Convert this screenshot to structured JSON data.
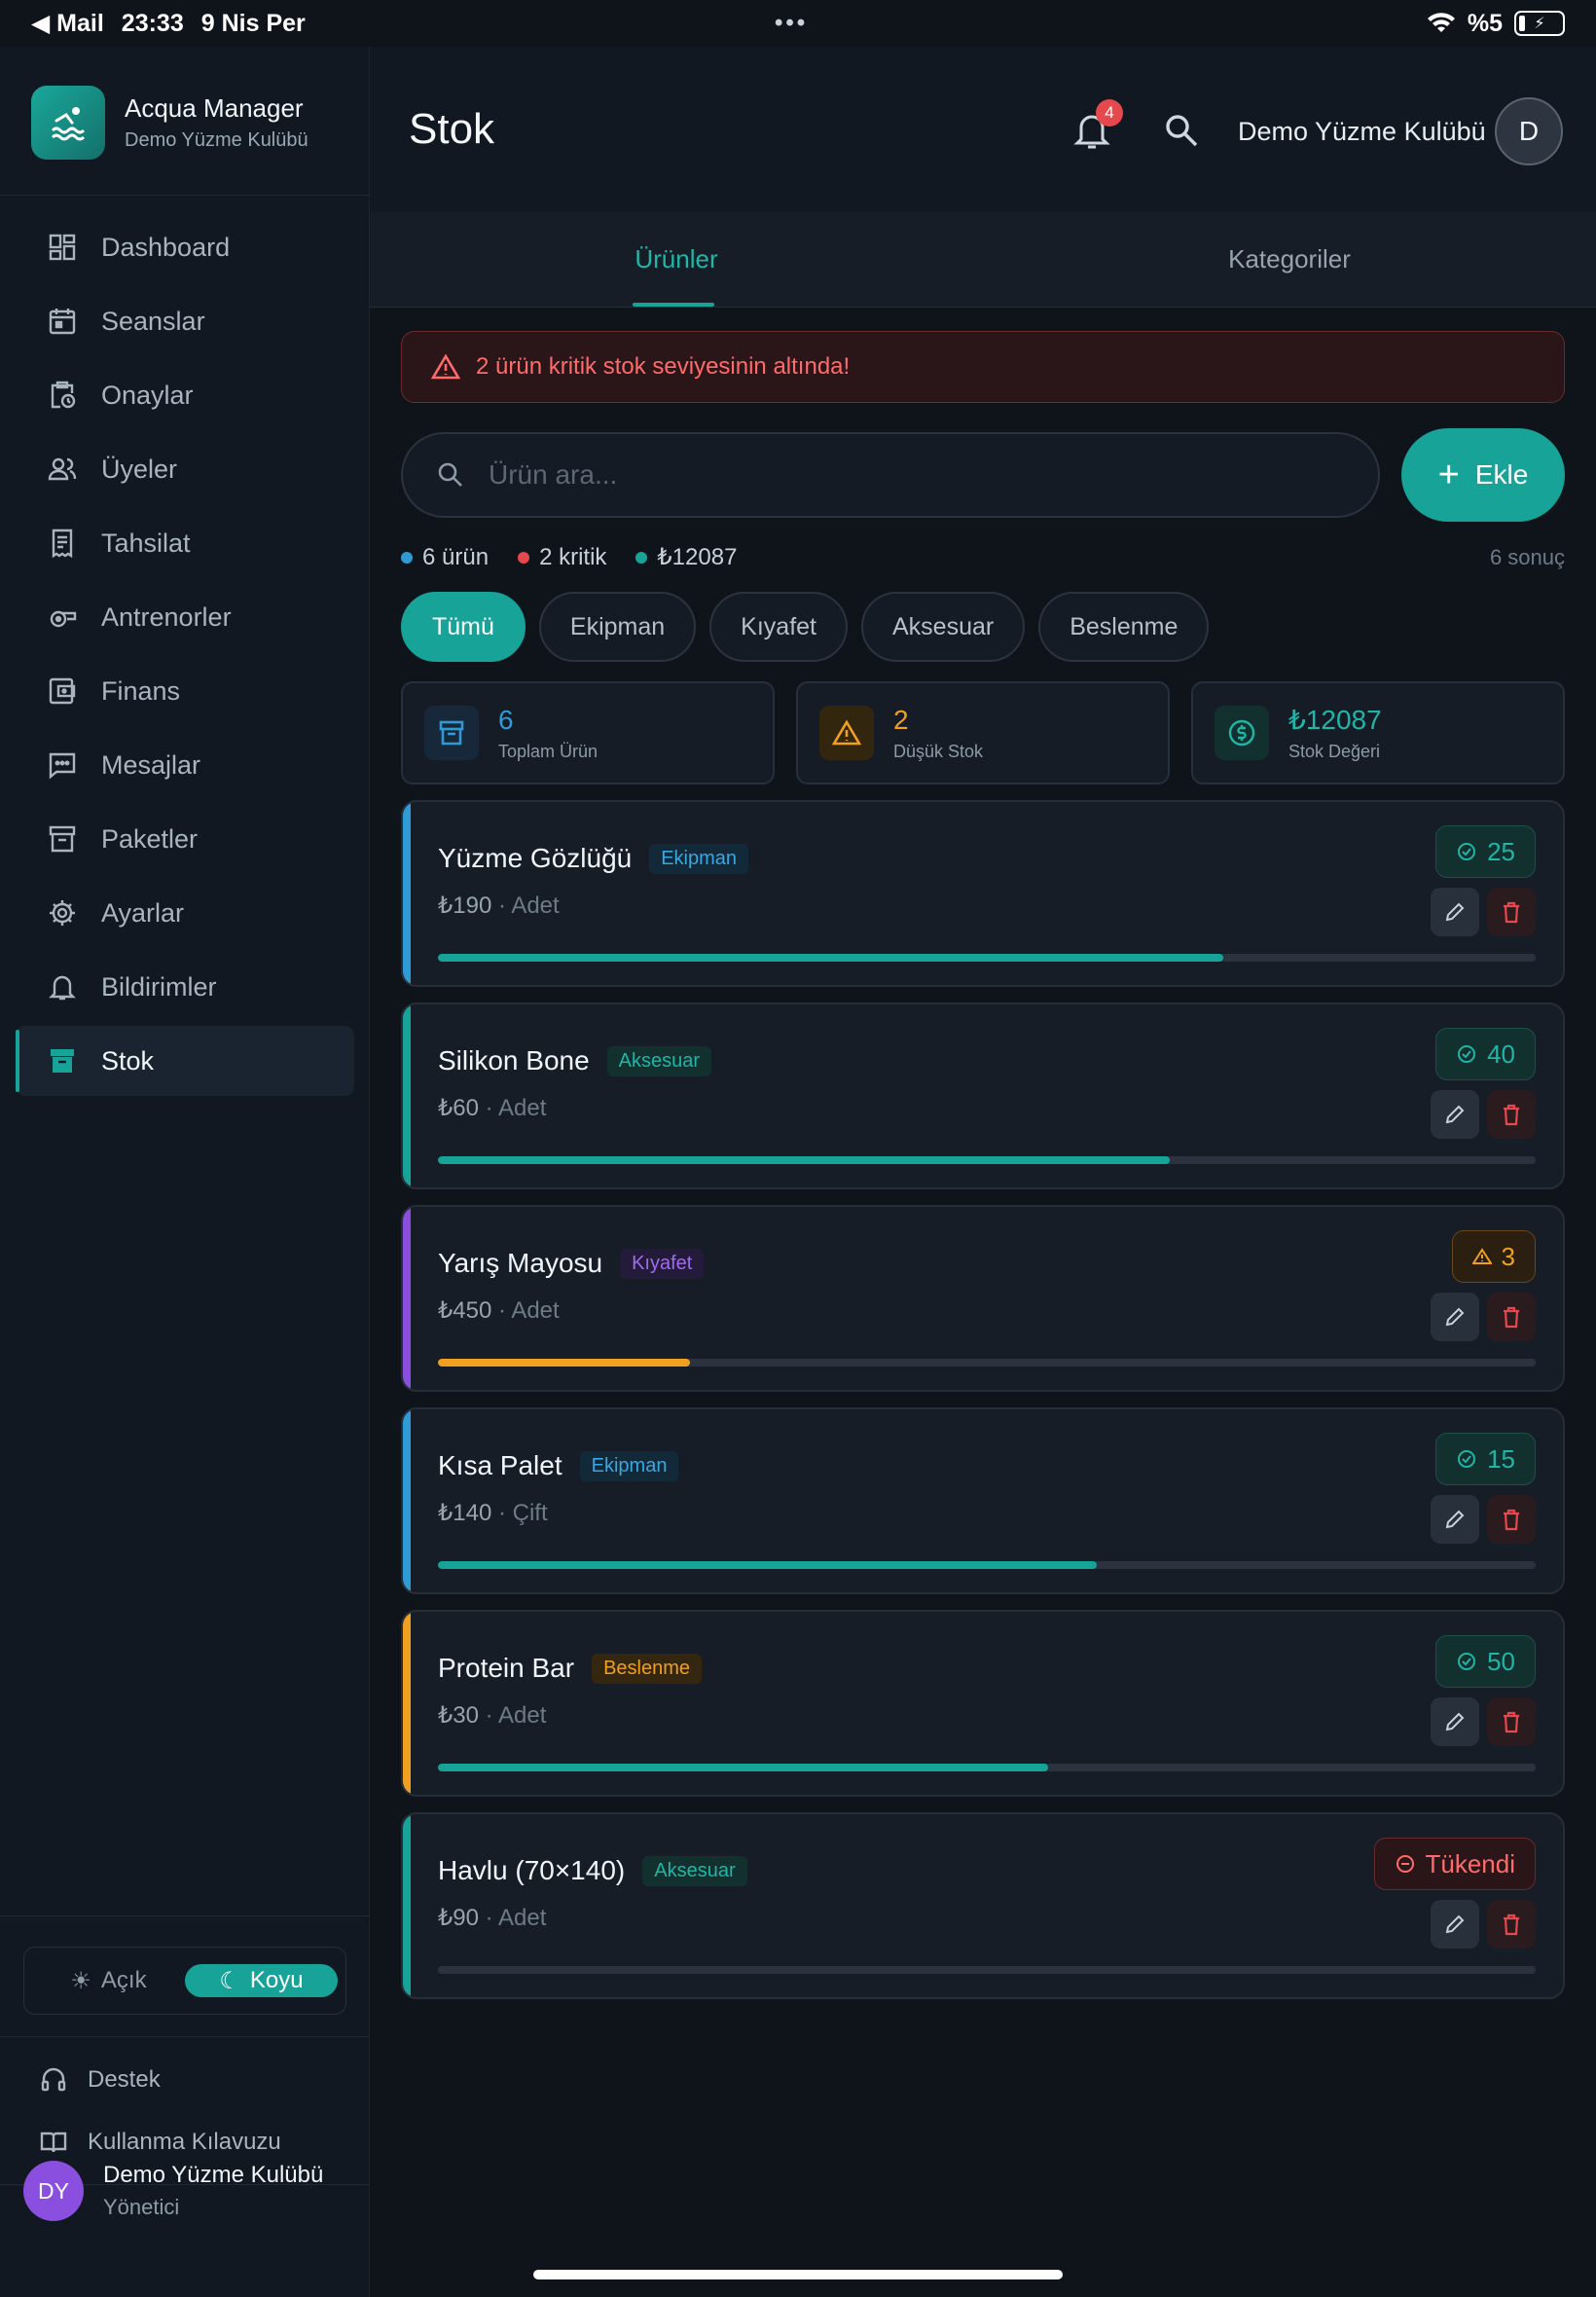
{
  "status_bar": {
    "back_app": "Mail",
    "time": "23:33",
    "date": "9 Nis Per",
    "battery": "%5"
  },
  "brand": {
    "title": "Acqua Manager",
    "subtitle": "Demo Yüzme Kulübü"
  },
  "nav": {
    "items": [
      {
        "label": "Dashboard",
        "icon": "dashboard-icon"
      },
      {
        "label": "Seanslar",
        "icon": "calendar-icon"
      },
      {
        "label": "Onaylar",
        "icon": "clipboard-clock-icon"
      },
      {
        "label": "Üyeler",
        "icon": "users-icon"
      },
      {
        "label": "Tahsilat",
        "icon": "receipt-icon"
      },
      {
        "label": "Antrenorler",
        "icon": "whistle-icon"
      },
      {
        "label": "Finans",
        "icon": "wallet-icon"
      },
      {
        "label": "Mesajlar",
        "icon": "message-icon"
      },
      {
        "label": "Paketler",
        "icon": "archive-icon"
      },
      {
        "label": "Ayarlar",
        "icon": "gear-icon"
      },
      {
        "label": "Bildirimler",
        "icon": "bell-icon"
      },
      {
        "label": "Stok",
        "icon": "archive-icon",
        "active": true
      }
    ]
  },
  "theme": {
    "light": "Açık",
    "dark": "Koyu",
    "selected": "Koyu"
  },
  "help": {
    "support": "Destek",
    "guide": "Kullanma Kılavuzu"
  },
  "user": {
    "initials": "DY",
    "name": "Demo Yüzme Kulübü",
    "role": "Yönetici"
  },
  "header": {
    "title": "Stok",
    "notification_count": "4",
    "club_name": "Demo Yüzme Kulübü",
    "avatar": "D"
  },
  "tabs": [
    {
      "label": "Ürünler",
      "active": true
    },
    {
      "label": "Kategoriler"
    }
  ],
  "alert": {
    "text": "2 ürün kritik stok seviyesinin altında!"
  },
  "search": {
    "placeholder": "Ürün ara..."
  },
  "add_button": {
    "label": "Ekle"
  },
  "summary": {
    "products": "6 ürün",
    "critical": "2 kritik",
    "value": "₺12087",
    "results": "6 sonuç"
  },
  "filters": [
    "Tümü",
    "Ekipman",
    "Kıyafet",
    "Aksesuar",
    "Beslenme"
  ],
  "active_filter": "Tümü",
  "stats": [
    {
      "value": "6",
      "label": "Toplam Ürün",
      "color": "#2f9bd6"
    },
    {
      "value": "2",
      "label": "Düşük Stok",
      "color": "#f0a020"
    },
    {
      "value": "₺12087",
      "label": "Stok Değeri",
      "color": "#1fb5a8"
    }
  ],
  "products": [
    {
      "name": "Yüzme Gözlüğü",
      "category": "Ekipman",
      "price": "₺190",
      "unit": "Adet",
      "stock": "25",
      "status": "ok",
      "level": 0.715,
      "accent": "#2f9bd6"
    },
    {
      "name": "Silikon Bone",
      "category": "Aksesuar",
      "price": "₺60",
      "unit": "Adet",
      "stock": "40",
      "status": "ok",
      "level": 0.667,
      "accent": "#17a398"
    },
    {
      "name": "Yarış Mayosu",
      "category": "Kıyafet",
      "price": "₺450",
      "unit": "Adet",
      "stock": "3",
      "status": "low",
      "level": 0.23,
      "accent": "#8b4fe0"
    },
    {
      "name": "Kısa Palet",
      "category": "Ekipman",
      "price": "₺140",
      "unit": "Çift",
      "stock": "15",
      "status": "ok",
      "level": 0.6,
      "accent": "#2f9bd6"
    },
    {
      "name": "Protein Bar",
      "category": "Beslenme",
      "price": "₺30",
      "unit": "Adet",
      "stock": "50",
      "status": "ok",
      "level": 0.556,
      "accent": "#f0a020"
    },
    {
      "name": "Havlu (70×140)",
      "category": "Aksesuar",
      "price": "₺90",
      "unit": "Adet",
      "stock": "Tükendi",
      "status": "out",
      "level": 0,
      "accent": "#17a398"
    }
  ],
  "colors": {
    "accent": "#17a398",
    "danger": "#e5484d",
    "warning": "#f0a020"
  }
}
